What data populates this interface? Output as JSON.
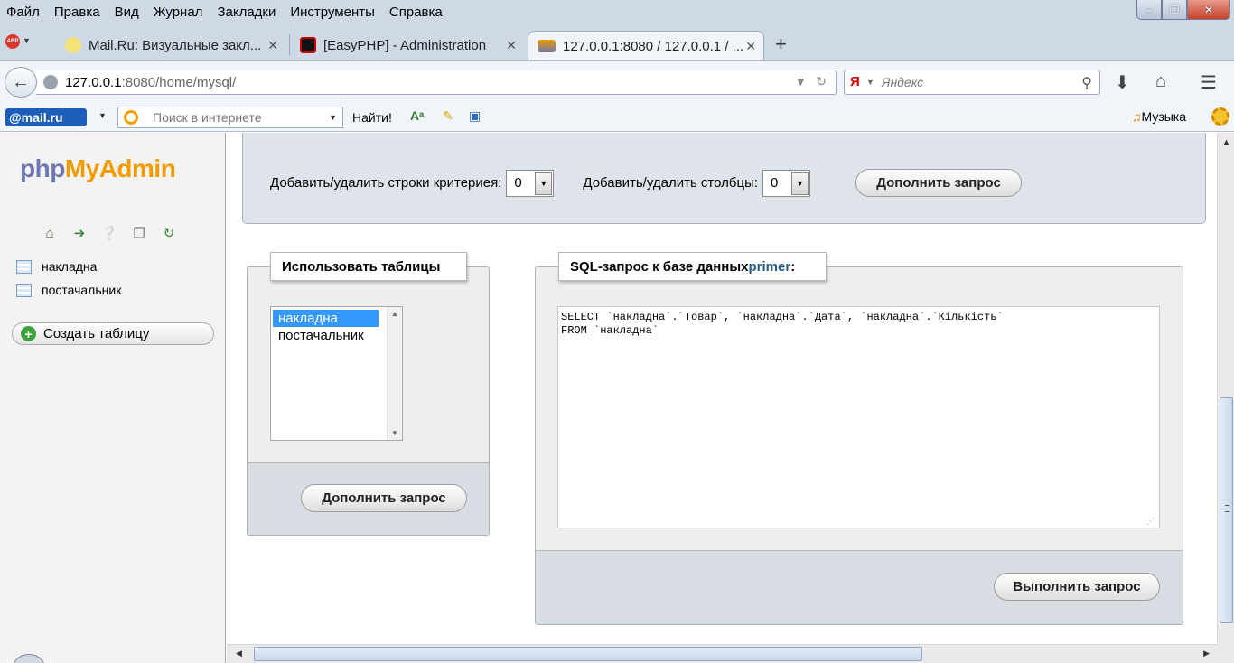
{
  "browser": {
    "menu": [
      "Файл",
      "Правка",
      "Вид",
      "Журнал",
      "Закладки",
      "Инструменты",
      "Справка"
    ],
    "window_controls": [
      "minimize",
      "maximize",
      "close"
    ],
    "tabs": [
      {
        "label": "Mail.Ru: Визуальные закл...",
        "active": false
      },
      {
        "label": "[EasyPHP] - Administration",
        "active": false
      },
      {
        "label": "127.0.0.1:8080 / 127.0.0.1 / ...",
        "active": true
      }
    ],
    "url_host": "127.0.0.1",
    "url_rest": ":8080/home/mysql/",
    "search_placeholder": "Яндекс",
    "search_engine_glyph": "Я",
    "mailru": {
      "logo": "@mail.ru",
      "search_placeholder": "Поиск в интернете",
      "find_label": "Найти!",
      "music_label": "Музыка"
    }
  },
  "sidebar": {
    "logo_php": "php",
    "logo_myadmin": "MyAdmin",
    "tables": [
      "накладна",
      "постачальник"
    ],
    "create_table_label": "Создать таблицу"
  },
  "main": {
    "criteria": {
      "add_rows_label": "Добавить/удалить строки критериея:",
      "add_rows_value": "0",
      "add_cols_label": "Добавить/удалить столбцы:",
      "add_cols_value": "0",
      "update_button": "Дополнить запрос"
    },
    "use_tables": {
      "legend": "Использовать таблицы",
      "options": [
        "накладна",
        "постачальник"
      ],
      "selected": "накладна",
      "update_button": "Дополнить запрос"
    },
    "sql": {
      "legend_prefix": "SQL-запрос к базе данных ",
      "db_name": "primer",
      "legend_suffix": ":",
      "query": "SELECT `накладна`.`Товар`, `накладна`.`Дата`, `накладна`.`Кількість`\nFROM `накладна`",
      "submit_button": "Выполнить запрос"
    }
  },
  "colors": {
    "chrome": "#cfd9e6",
    "selection": "#3399ff",
    "db_link": "#235a81",
    "logo_orange": "#f29b00",
    "logo_php": "#6c78af"
  }
}
